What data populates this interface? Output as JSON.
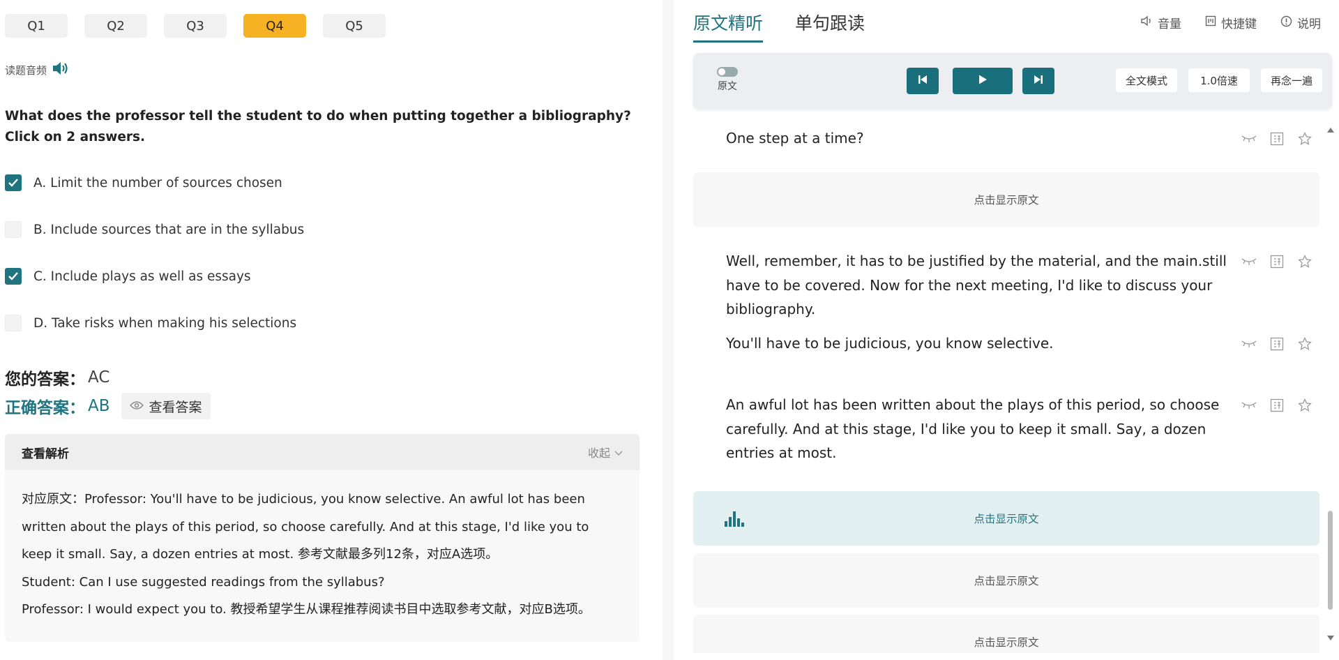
{
  "question_tabs": [
    {
      "label": "Q1",
      "active": false
    },
    {
      "label": "Q2",
      "active": false
    },
    {
      "label": "Q3",
      "active": false
    },
    {
      "label": "Q4",
      "active": true
    },
    {
      "label": "Q5",
      "active": false
    }
  ],
  "audio_label": "读题音频",
  "question_text": "What does the professor tell the student to do when putting together a bibliography? Click on 2 answers.",
  "options": [
    {
      "text": "A. Limit the number of sources chosen",
      "checked": true
    },
    {
      "text": "B. Include sources that are in the syllabus",
      "checked": false
    },
    {
      "text": "C. Include plays as well as essays",
      "checked": true
    },
    {
      "text": "D. Take risks when making his selections",
      "checked": false
    }
  ],
  "your_answer": {
    "label": "您的答案：",
    "value": "AC"
  },
  "correct_answer": {
    "label": "正确答案：",
    "value": "AB",
    "view_label": "查看答案"
  },
  "analysis": {
    "title": "查看解析",
    "collapse_label": "收起",
    "lines": [
      "对应原文：Professor: You'll have to be judicious, you know selective. An awful lot has been written about the plays of this period, so choose carefully. And at this stage, I'd like you to keep it small. Say, a dozen entries at most. 参考文献最多列12条，对应A选项。",
      "Student: Can I use suggested readings from the syllabus?",
      "Professor: I would expect you to. 教授希望学生从课程推荐阅读书目中选取参考文献，对应B选项。"
    ]
  },
  "right_tabs": [
    {
      "label": "原文精听",
      "active": true
    },
    {
      "label": "单句跟读",
      "active": false
    }
  ],
  "right_tools": {
    "volume": "音量",
    "shortcuts": "快捷键",
    "help": "说明"
  },
  "player": {
    "original_toggle_label": "原文",
    "full_text_mode": "全文模式",
    "speed": "1.0倍速",
    "repeat": "再念一遍"
  },
  "transcript": {
    "show_original_label": "点击显示原文",
    "sentences": [
      "One step at a time?",
      "Well, remember, it has to be justified by the material, and the main.still have to be covered. Now for the next meeting, I'd like to discuss your bibliography.",
      "You'll have to be judicious, you know selective.",
      "An awful lot has been written about the plays of this period, so choose carefully. And at this stage, I'd like you to keep it small. Say, a dozen entries at most."
    ]
  },
  "colors": {
    "accent": "#1f7480",
    "active_tab": "#f7b224"
  }
}
